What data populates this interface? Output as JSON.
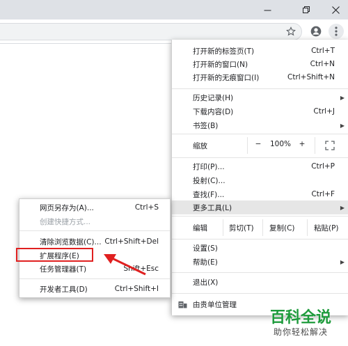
{
  "main_menu": {
    "items": [
      {
        "label": "打开新的标签页(T)",
        "shortcut": "Ctrl+T"
      },
      {
        "label": "打开新的窗口(N)",
        "shortcut": "Ctrl+N"
      },
      {
        "label": "打开新的无痕窗口(I)",
        "shortcut": "Ctrl+Shift+N"
      },
      {
        "label": "历史记录(H)",
        "shortcut": ""
      },
      {
        "label": "下载内容(D)",
        "shortcut": "Ctrl+J"
      },
      {
        "label": "书签(B)",
        "shortcut": ""
      },
      {
        "label": "打印(P)...",
        "shortcut": "Ctrl+P"
      },
      {
        "label": "投射(C)...",
        "shortcut": ""
      },
      {
        "label": "查找(F)...",
        "shortcut": "Ctrl+F"
      },
      {
        "label": "更多工具(L)",
        "shortcut": ""
      },
      {
        "label": "设置(S)",
        "shortcut": ""
      },
      {
        "label": "帮助(E)",
        "shortcut": ""
      },
      {
        "label": "退出(X)",
        "shortcut": ""
      }
    ],
    "zoom": {
      "label": "缩放",
      "minus": "−",
      "value": "100%",
      "plus": "+"
    },
    "edit": {
      "label": "编辑",
      "cut": "剪切(T)",
      "copy": "复制(C)",
      "paste": "粘贴(P)"
    },
    "managed": "由贵单位管理"
  },
  "sub_menu": {
    "items": [
      {
        "label": "网页另存为(A)...",
        "shortcut": "Ctrl+S"
      },
      {
        "label": "创建快捷方式...",
        "shortcut": ""
      },
      {
        "label": "清除浏览数据(C)...",
        "shortcut": "Ctrl+Shift+Del"
      },
      {
        "label": "扩展程序(E)",
        "shortcut": ""
      },
      {
        "label": "任务管理器(T)",
        "shortcut": "Shift+Esc"
      },
      {
        "label": "开发者工具(D)",
        "shortcut": "Ctrl+Shift+I"
      }
    ]
  },
  "watermark": {
    "title": "百科全说",
    "subtitle": "助你轻松解决"
  },
  "colors": {
    "annotation_red": "#e02020",
    "watermark_green": "#1e9b3c"
  }
}
